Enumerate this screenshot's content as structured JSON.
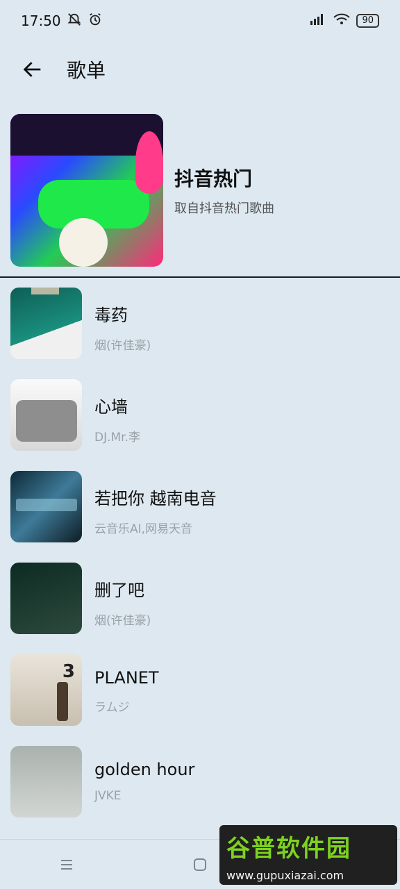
{
  "status": {
    "time": "17:50",
    "battery": "90"
  },
  "header": {
    "title": "歌单"
  },
  "playlist": {
    "title": "抖音热门",
    "subtitle": "取自抖音热门歌曲"
  },
  "songs": [
    {
      "title": "毒药",
      "artist": "烟(许佳豪)"
    },
    {
      "title": "心墙",
      "artist": "DJ.Mr.李"
    },
    {
      "title": "若把你 越南电音",
      "artist": "云音乐AI,网易天音"
    },
    {
      "title": "删了吧",
      "artist": "烟(许佳豪)"
    },
    {
      "title": "PLANET",
      "artist": "ラムジ",
      "cover_number": "3"
    },
    {
      "title": "golden hour",
      "artist": "JVKE"
    }
  ],
  "watermark": {
    "line1": "谷普软件园",
    "line2": "www.gupuxiazai.com"
  }
}
